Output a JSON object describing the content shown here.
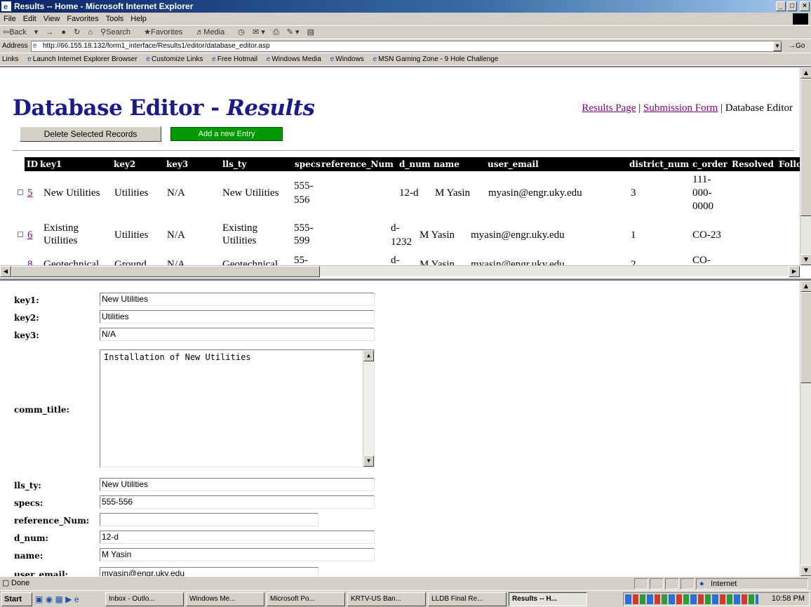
{
  "window": {
    "title": "Results -- Home - Microsoft Internet Explorer"
  },
  "menu": [
    "File",
    "Edit",
    "View",
    "Favorites",
    "Tools",
    "Help"
  ],
  "toolbar": {
    "back": "Back",
    "forward": "→",
    "search": "Search",
    "favorites": "Favorites",
    "media": "Media"
  },
  "address": {
    "label": "Address",
    "url": "http://66.155.18.132/form1_interface/Results1/editor/database_editor.asp",
    "go": "Go"
  },
  "links": {
    "label": "Links",
    "items": [
      "Launch Internet Explorer Browser",
      "Customize Links",
      "Free Hotmail",
      "Windows Media",
      "Windows",
      "MSN Gaming Zone - 9 Hole Challenge"
    ]
  },
  "page": {
    "title_main": "Database Editor - ",
    "title_italic": "Results",
    "nav": {
      "results": "Results Page",
      "sep1": " | ",
      "submission": "Submission Form",
      "sep2": " | ",
      "editor": "Database Editor"
    },
    "delete_button": "Delete Selected Records",
    "add_button": "Add a new Entry"
  },
  "table": {
    "headers": [
      "ID",
      "key1",
      "key2",
      "key3",
      "lls_ty",
      "specs",
      "reference_Num",
      "d_num",
      "name",
      "user_email",
      "district_num",
      "c_order",
      "Resolved",
      "Follo"
    ],
    "rows": [
      {
        "id": "5",
        "key1": "New Utilities",
        "key2": "Utilities",
        "key3": "N/A",
        "lls_ty": "New Utilities",
        "specs_a": "555-",
        "specs_b": "556",
        "d_num_a": "",
        "d_num_b": "12-d",
        "name": "M Yasin",
        "email": "myasin@engr.uky.edu",
        "district": "3",
        "c_order_a": "111-",
        "c_order_b": "000-",
        "c_order_c": "0000"
      },
      {
        "id": "6",
        "key1_a": "Existing",
        "key1_b": "Utilities",
        "key2": "Utilities",
        "key3": "N/A",
        "lls_ty_a": "Existing",
        "lls_ty_b": "Utilities",
        "specs_a": "555-",
        "specs_b": "599",
        "d_num_a": "d-",
        "d_num_b": "1232",
        "name": "M Yasin",
        "email": "myasin@engr.uky.edu",
        "district": "1",
        "c_order": "CO-23"
      },
      {
        "id": "8",
        "key1": "Geotechnical",
        "key2": "Ground",
        "key3": "N/A",
        "lls_ty": "Geotechnical",
        "specs": "55-",
        "d_num": "d-",
        "name": "M Yasin",
        "email": "myasin@engr.uky.edu",
        "district": "2",
        "c_order": "CO-"
      }
    ]
  },
  "form": {
    "key1_label": "key1:",
    "key1_value": "New Utilities",
    "key2_label": "key2:",
    "key2_value": "Utilities",
    "key3_label": "key3:",
    "key3_value": "N/A",
    "comm_title_label": "comm_title:",
    "comm_title_value": "Installation of New Utilities",
    "lls_ty_label": "lls_ty:",
    "lls_ty_value": "New Utilities",
    "specs_label": "specs:",
    "specs_value": "555-556",
    "reference_num_label": "reference_Num:",
    "reference_num_value": "",
    "d_num_label": "d_num:",
    "d_num_value": "12-d",
    "name_label": "name:",
    "name_value": "M Yasin",
    "user_email_label": "user_email:",
    "user_email_value": "myasin@engr.uky.edu"
  },
  "status": {
    "text": "Done",
    "zone": "Internet"
  },
  "taskbar": {
    "start": "Start",
    "buttons": [
      "Inbox - Outlo...",
      "Windows Me...",
      "Microsoft Po...",
      "KRTV-US Ban...",
      "LLDB Final Re...",
      "Results -- H..."
    ],
    "clock": "10:58 PM"
  }
}
